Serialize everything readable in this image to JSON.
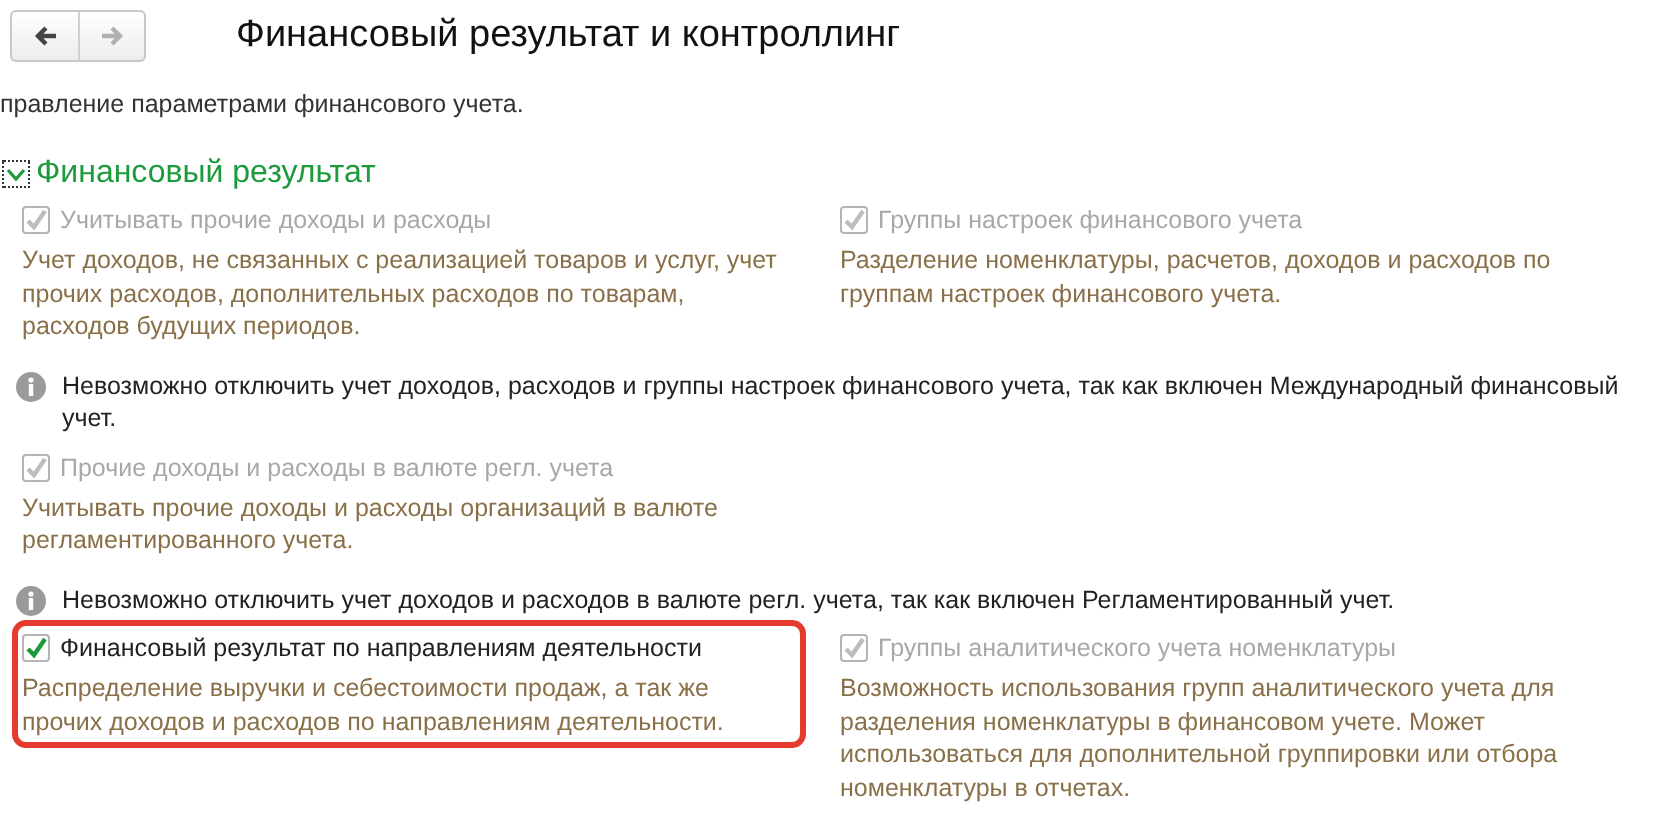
{
  "nav": {
    "buttons": [
      {
        "kind": "back",
        "disabled": false
      },
      {
        "kind": "forward",
        "disabled": true
      }
    ]
  },
  "title": "Финансовый результат и контроллинг",
  "intro": "правление параметрами финансового учета.",
  "group": {
    "title": "Финансовый результат",
    "expanded": true,
    "rows": [
      {
        "kind": "pair",
        "options": [
          {
            "label": "Учитывать прочие доходы и расходы",
            "checked": true,
            "disabled": true,
            "highlighted": false,
            "description": "Учет доходов, не связанных с реализацией товаров и услуг, учет прочих расходов, дополнительных расходов по товарам, расходов будущих периодов."
          },
          {
            "label": "Группы настроек финансового учета",
            "checked": true,
            "disabled": true,
            "highlighted": false,
            "description": "Разделение номенклатуры, расчетов, доходов и расходов по группам настроек финансового учета."
          }
        ]
      },
      {
        "kind": "info",
        "text": "Невозможно отключить учет доходов, расходов и группы настроек финансового учета, так как включен Международный финансовый учет."
      },
      {
        "kind": "pair",
        "options": [
          {
            "label": "Прочие доходы и расходы в валюте регл. учета",
            "checked": true,
            "disabled": true,
            "highlighted": false,
            "description": "Учитывать прочие доходы и расходы организаций в валюте регламентированного учета."
          }
        ]
      },
      {
        "kind": "info",
        "text": "Невозможно отключить учет доходов и расходов в валюте регл. учета, так как включен Регламентированный учет."
      },
      {
        "kind": "pair",
        "options": [
          {
            "label": "Финансовый результат по направлениям деятельности",
            "checked": true,
            "disabled": false,
            "highlighted": true,
            "description": "Распределение выручки и себестоимости продаж, а так же прочих доходов и расходов по направлениям деятельности."
          },
          {
            "label": "Группы аналитического учета номенклатуры",
            "checked": true,
            "disabled": true,
            "highlighted": false,
            "description": "Возможность использования групп аналитического учета для разделения номенклатуры в финансовом учете. Может использоваться для дополнительной группировки или отбора номенклатуры в отчетах."
          }
        ]
      }
    ]
  }
}
